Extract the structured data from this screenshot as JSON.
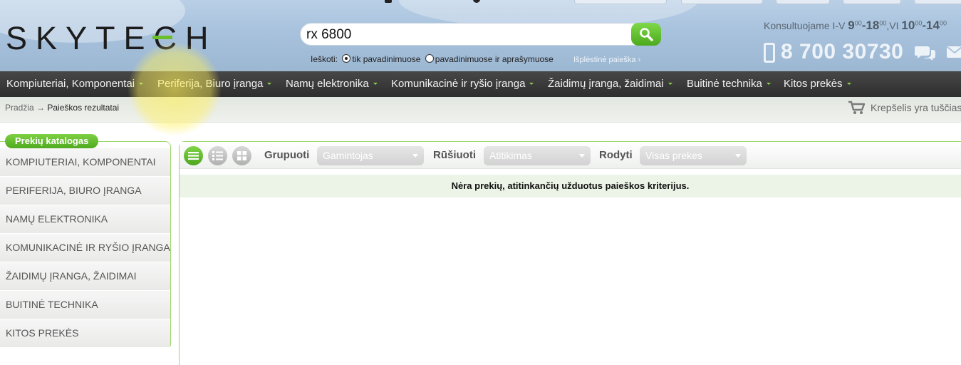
{
  "header": {
    "logo_text": "SKYTECH",
    "search": {
      "value": "rx 6800",
      "placeholder": ""
    },
    "search_in_label": "Ieškoti:",
    "option_names_only": "tik pavadinimuose",
    "option_names_desc": "pavadinimuose ir aprašymuose",
    "advanced_search": "Išplėstinė paieška ›",
    "consult_prefix": "Konsultuojame I-V",
    "weekday_from": "9",
    "weekday_from_min": "00",
    "weekday_to": "18",
    "weekday_to_min": "00",
    "saturday_label": ",VI",
    "saturday_from": "10",
    "saturday_from_min": "00",
    "saturday_to": "14",
    "saturday_to_min": "00",
    "phone": "8 700 30730"
  },
  "nav": {
    "items": [
      {
        "label": "Kompiuteriai, Komponentai"
      },
      {
        "label": "Periferija, Biuro įranga"
      },
      {
        "label": "Namų elektronika"
      },
      {
        "label": "Komunikacinė ir ryšio įranga"
      },
      {
        "label": "Žaidimų įranga, žaidimai"
      },
      {
        "label": "Buitinė technika"
      },
      {
        "label": "Kitos prekės"
      }
    ]
  },
  "breadcrumb": {
    "home": "Pradžia",
    "arrow": "→",
    "current": "Paieškos rezultatai"
  },
  "cart": {
    "label": "Krepšelis yra tuščias"
  },
  "sidebar": {
    "title": "Prekių katalogas",
    "items": [
      {
        "label": "KOMPIUTERIAI, KOMPONENTAI"
      },
      {
        "label": "PERIFERIJA, BIURO ĮRANGA"
      },
      {
        "label": "NAMŲ ELEKTRONIKA"
      },
      {
        "label": "KOMUNIKACINĖ IR RYŠIO ĮRANGA"
      },
      {
        "label": "ŽAIDIMŲ ĮRANGA, ŽAIDIMAI"
      },
      {
        "label": "BUITINĖ TECHNIKA"
      },
      {
        "label": "KITOS PREKĖS"
      }
    ]
  },
  "toolbar": {
    "group_label": "Grupuoti",
    "group_value": "Gamintojas",
    "sort_label": "Rūšiuoti",
    "sort_value": "Atitikimas",
    "show_label": "Rodyti",
    "show_value": "Visas prekes"
  },
  "results": {
    "empty_message": "Nėra prekių, atitinkančių užduotus paieškos kriterijus."
  },
  "colors": {
    "accent_green": "#5cb82a",
    "nav_bg": "#3a3a3a",
    "header_sky": "#a9c3de"
  }
}
